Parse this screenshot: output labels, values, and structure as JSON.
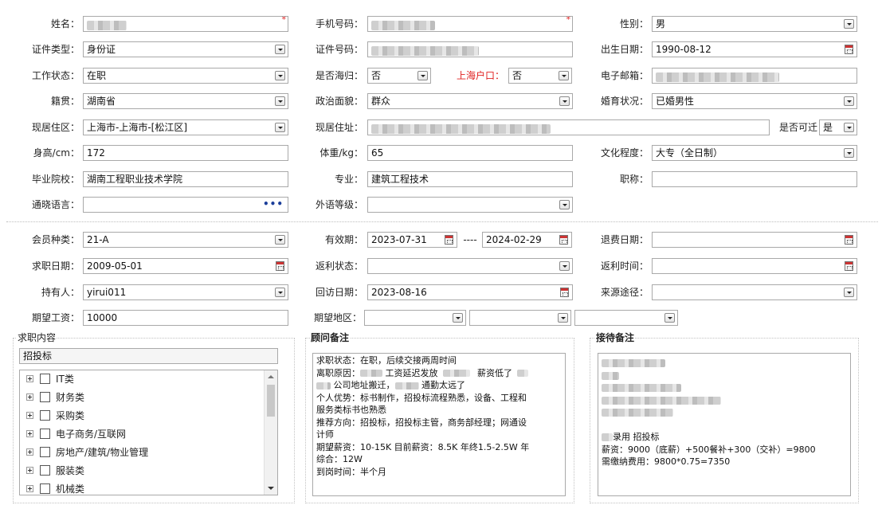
{
  "form": {
    "name": {
      "label": "姓名：",
      "required": "*"
    },
    "phone": {
      "label": "手机号码：",
      "required": "*"
    },
    "gender": {
      "label": "性别：",
      "value": "男"
    },
    "id_type": {
      "label": "证件类型：",
      "value": "身份证"
    },
    "id_number": {
      "label": "证件号码："
    },
    "birth_date": {
      "label": "出生日期：",
      "value": "1990-08-12"
    },
    "work_status": {
      "label": "工作状态：",
      "value": "在职"
    },
    "returnee": {
      "label": "是否海归：",
      "value": "否"
    },
    "shanghai_hukou": {
      "label": "上海户口：",
      "value": "否"
    },
    "email": {
      "label": "电子邮箱："
    },
    "native_place": {
      "label": "籍贯：",
      "value": "湖南省"
    },
    "political_status": {
      "label": "政治面貌：",
      "value": "群众"
    },
    "marital_status": {
      "label": "婚育状况：",
      "value": "已婚男性"
    },
    "residence_area": {
      "label": "现居住区：",
      "value": "上海市-上海市-[松江区]"
    },
    "residence_address": {
      "label": "现居住址："
    },
    "relocate": {
      "label": "是否可迁",
      "value": "是"
    },
    "height": {
      "label": "身高/cm：",
      "value": "172"
    },
    "weight": {
      "label": "体重/kg：",
      "value": "65"
    },
    "education": {
      "label": "文化程度：",
      "value": "大专（全日制）"
    },
    "school": {
      "label": "毕业院校：",
      "value": "湖南工程职业技术学院"
    },
    "major": {
      "label": "专业：",
      "value": "建筑工程技术"
    },
    "title": {
      "label": "职称："
    },
    "languages": {
      "label": "通晓语言：",
      "more": "•••"
    },
    "foreign_level": {
      "label": "外语等级："
    }
  },
  "membership": {
    "member_type": {
      "label": "会员种类：",
      "value": "21-A"
    },
    "validity": {
      "label": "有效期：",
      "start": "2023-07-31",
      "sep": "----",
      "end": "2024-02-29"
    },
    "refund_date": {
      "label": "退费日期："
    },
    "job_date": {
      "label": "求职日期：",
      "value": "2009-05-01"
    },
    "rebate_status": {
      "label": "返利状态："
    },
    "rebate_time": {
      "label": "返利时间："
    },
    "holder": {
      "label": "持有人：",
      "value": "yirui011"
    },
    "revisit_date": {
      "label": "回访日期：",
      "value": "2023-08-16"
    },
    "source": {
      "label": "来源途径："
    },
    "expected_salary": {
      "label": "期望工资：",
      "value": "10000"
    },
    "expected_region": {
      "label": "期望地区："
    }
  },
  "job_content": {
    "legend": "求职内容",
    "selected": "招投标",
    "items": [
      "IT类",
      "财务类",
      "采购类",
      "电子商务/互联网",
      "房地产/建筑/物业管理",
      "服装类",
      "机械类"
    ]
  },
  "advisor_note": {
    "legend": "顾问备注",
    "lines": [
      "求职状态：在职，后续交接两周时间",
      "离职原因：",
      "工资延迟发放",
      "薪资低了",
      "公司地址搬迁，",
      "通勤太远了",
      "个人优势：标书制作，招投标流程熟悉，设备、工程和",
      "服务类标书也熟悉",
      "推荐方向：招投标，招投标主管，商务部经理；网通设",
      "计师",
      "期望薪资：10-15K 目前薪资：8.5K  年终1.5-2.5W 年",
      "综合：12W",
      "到岗时间：半个月"
    ]
  },
  "reception_note": {
    "legend": "接待备注",
    "line1": "录用 招投标",
    "line2": "薪资：9000（底薪）+500餐补+300（交补）=9800",
    "line3": "需缴纳费用：9800*0.75=7350"
  },
  "colors": {
    "required": "#e02020",
    "border": "#a9a9a9",
    "more_dots": "#1b3e9a"
  }
}
